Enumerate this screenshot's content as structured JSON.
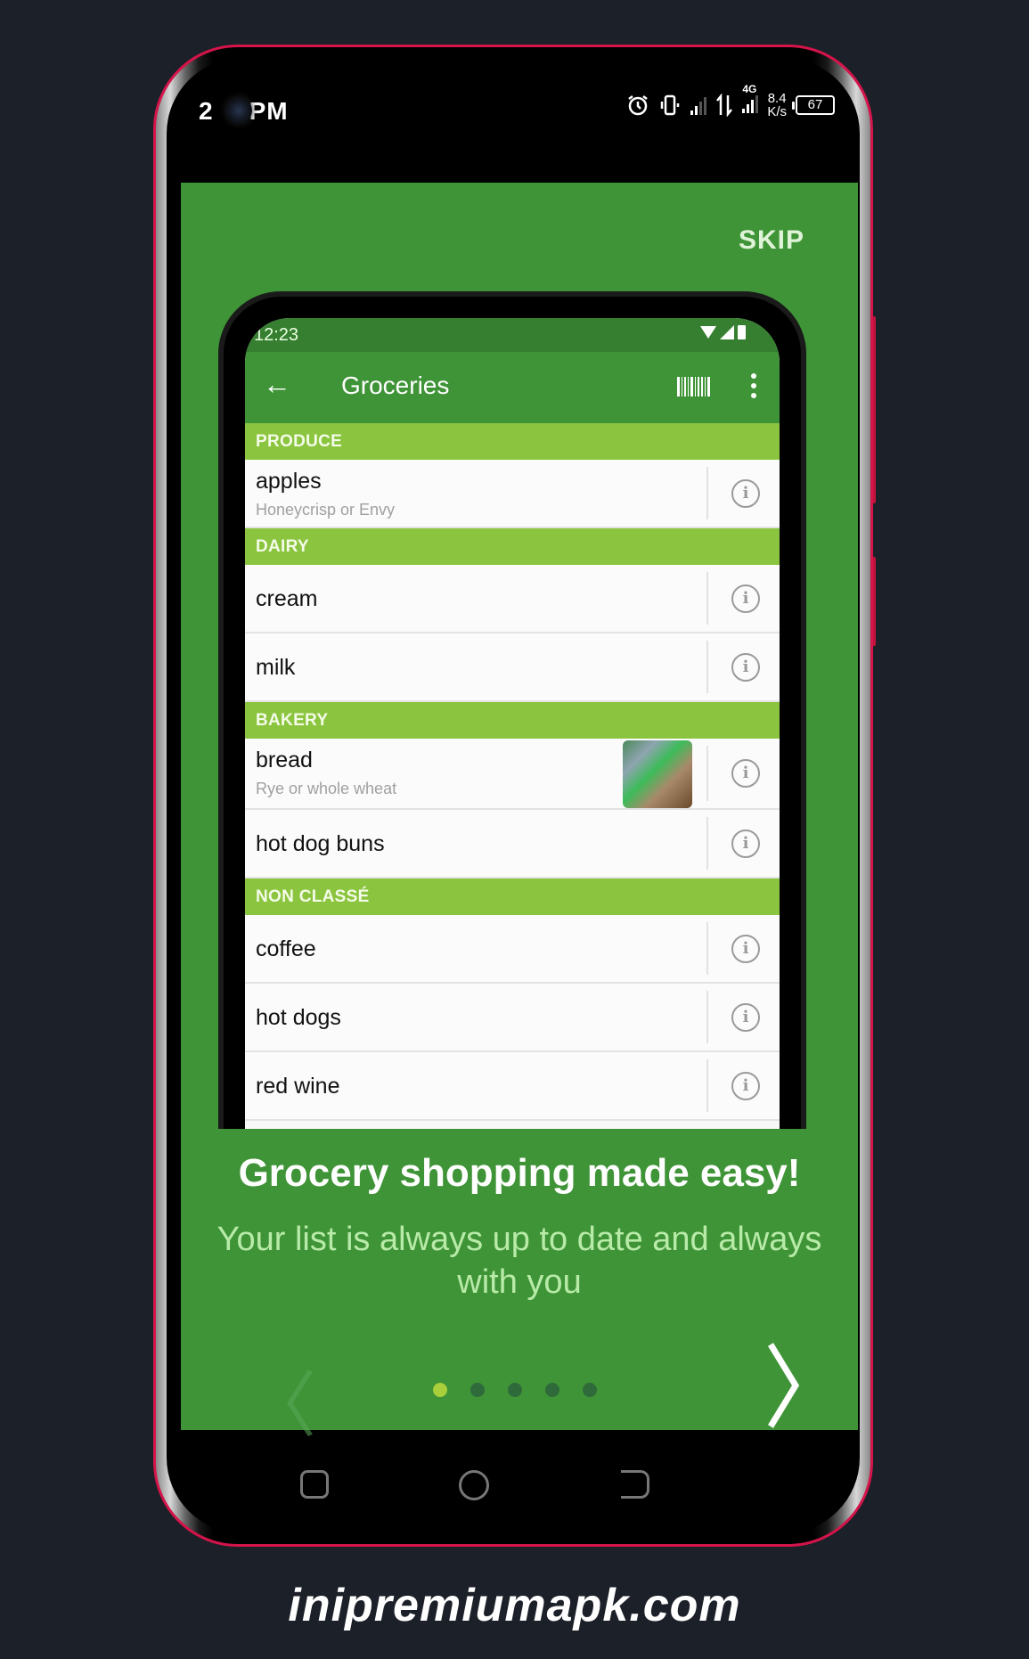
{
  "device_status": {
    "time": "2",
    "ampm": "PM",
    "network_type": "4G",
    "speed_value": "8.4",
    "speed_unit": "K/s",
    "battery": "67",
    "icons": [
      "alarm-icon",
      "vibrate-icon",
      "signal-icon",
      "data-transfer-icon",
      "signal-4g-icon",
      "battery-icon"
    ]
  },
  "onboarding": {
    "skip_label": "SKIP",
    "headline": "Grocery shopping made easy!",
    "subline": "Your list is always up to date and always with you",
    "page_indicator": {
      "total": 5,
      "current": 1
    },
    "prev_icon": "chevron-left-icon",
    "next_icon": "chevron-right-icon",
    "colors": {
      "background": "#3f9437",
      "dot_active": "#a9cf3a",
      "dot_inactive": "#2f6a3a",
      "section": "#8bc53f"
    }
  },
  "mock_app": {
    "status_time": "12:23",
    "title": "Groceries",
    "sections": [
      {
        "name": "PRODUCE",
        "items": [
          {
            "name": "apples",
            "desc": "Honeycrisp or Envy"
          }
        ]
      },
      {
        "name": "DAIRY",
        "items": [
          {
            "name": "cream",
            "desc": ""
          },
          {
            "name": "milk",
            "desc": ""
          }
        ]
      },
      {
        "name": "BAKERY",
        "items": [
          {
            "name": "bread",
            "desc": "Rye or whole wheat",
            "has_photo": true
          },
          {
            "name": "hot dog buns",
            "desc": ""
          }
        ]
      },
      {
        "name": "NON CLASSÉ",
        "items": [
          {
            "name": "coffee",
            "desc": ""
          },
          {
            "name": "hot dogs",
            "desc": ""
          },
          {
            "name": "red wine",
            "desc": ""
          }
        ]
      }
    ],
    "info_glyph": "i"
  },
  "watermark": "inipremiumapk.com"
}
